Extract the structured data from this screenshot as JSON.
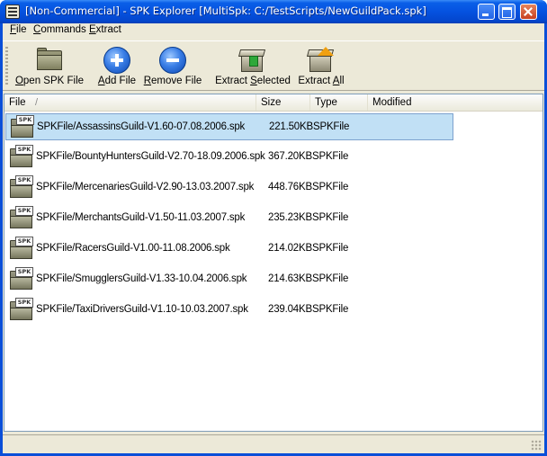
{
  "window": {
    "title": "[Non-Commercial] - SPK Explorer [MultiSpk: C:/TestScripts/NewGuildPack.spk]"
  },
  "menu": [
    {
      "label": "File",
      "accel": "F",
      "rest": "ile"
    },
    {
      "label": "Commands",
      "accel": "C",
      "rest": "ommands"
    },
    {
      "label": "Extract",
      "accel": "E",
      "rest": "xtract"
    }
  ],
  "toolbar": {
    "open": {
      "accel": "O",
      "rest": "pen SPK File",
      "icon": "folder-icon"
    },
    "add": {
      "accel": "A",
      "rest": "dd File",
      "icon": "add-icon"
    },
    "remove": {
      "accel": "R",
      "rest": "emove File",
      "icon": "remove-icon"
    },
    "extract_selected": {
      "pre": "Extract ",
      "accel": "S",
      "rest": "elected",
      "icon": "extract-selected-icon"
    },
    "extract_all": {
      "pre": "Extract ",
      "accel": "A",
      "rest": "ll",
      "icon": "extract-all-icon"
    }
  },
  "list": {
    "columns": [
      "File",
      "Size",
      "Type",
      "Modified"
    ],
    "sort_indicator": "/",
    "file_badge": "SPK",
    "rows": [
      {
        "file": "SPKFile/AssassinsGuild-V1.60-07.08.2006.spk",
        "size": "221.50KB",
        "type": "SPKFile",
        "selected": true
      },
      {
        "file": "SPKFile/BountyHuntersGuild-V2.70-18.09.2006.spk",
        "size": "367.20KB",
        "type": "SPKFile",
        "selected": false
      },
      {
        "file": "SPKFile/MercenariesGuild-V2.90-13.03.2007.spk",
        "size": "448.76KB",
        "type": "SPKFile",
        "selected": false
      },
      {
        "file": "SPKFile/MerchantsGuild-V1.50-11.03.2007.spk",
        "size": "235.23KB",
        "type": "SPKFile",
        "selected": false
      },
      {
        "file": "SPKFile/RacersGuild-V1.00-11.08.2006.spk",
        "size": "214.02KB",
        "type": "SPKFile",
        "selected": false
      },
      {
        "file": "SPKFile/SmugglersGuild-V1.33-10.04.2006.spk",
        "size": "214.63KB",
        "type": "SPKFile",
        "selected": false
      },
      {
        "file": "SPKFile/TaxiDriversGuild-V1.10-10.03.2007.spk",
        "size": "239.04KB",
        "type": "SPKFile",
        "selected": false
      }
    ]
  },
  "colors": {
    "titlebar": "#0552e0",
    "selection": "#c1e0f5",
    "face": "#ece9d8"
  }
}
